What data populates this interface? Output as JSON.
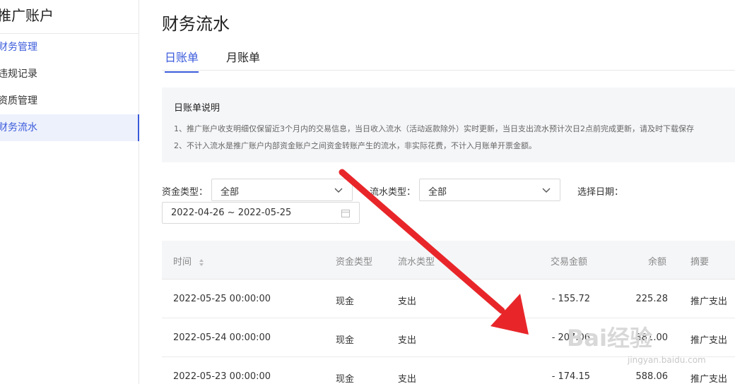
{
  "sidebar": {
    "title": "推广账户",
    "items": [
      {
        "label": "财务管理"
      },
      {
        "label": "违规记录"
      },
      {
        "label": "资质管理"
      },
      {
        "label": "财务流水"
      }
    ]
  },
  "main": {
    "title": "财务流水",
    "tabs": [
      {
        "label": "日账单"
      },
      {
        "label": "月账单"
      }
    ],
    "notice": {
      "title": "日账单说明",
      "lines": [
        "1、推广账户收支明细仅保留近3个月内的交易信息，当日收入流水（活动返款除外）实时更新，当日支出流水预计次日2点前完成更新，请及时下载保存",
        "2、不计入流水是推广账户内部资金账户之间资金转账产生的流水，非实际花费，不计入月账单开票金额。"
      ]
    },
    "filters": {
      "fund_type_label": "资金类型：",
      "fund_type_value": "全部",
      "flow_type_label": "流水类型：",
      "flow_type_value": "全部",
      "date_label": "选择日期：",
      "date_range": "2022-04-26 ~ 2022-05-25"
    },
    "table": {
      "columns": [
        "时间",
        "资金类型",
        "流水类型",
        "交易金额",
        "余额",
        "摘要"
      ],
      "rows": [
        {
          "time": "2022-05-25 00:00:00",
          "fund": "现金",
          "flow": "支出",
          "amount": "- 155.72",
          "balance": "225.28",
          "summary": "推广支出"
        },
        {
          "time": "2022-05-24 00:00:00",
          "fund": "现金",
          "flow": "支出",
          "amount": "- 207.06",
          "balance": "381.00",
          "summary": "推广支出"
        },
        {
          "time": "2022-05-23 00:00:00",
          "fund": "现金",
          "flow": "支出",
          "amount": "- 174.15",
          "balance": "588.06",
          "summary": "推广支出"
        }
      ]
    }
  },
  "overlay": {
    "arrow_color": "#e8262a",
    "watermark_text": "Bai经验",
    "watermark_url": "jingyan.baidu.com"
  },
  "colors": {
    "accent": "#3b5bdb",
    "active_bg": "#edf1fc",
    "panel_bg": "#f5f6f8"
  }
}
